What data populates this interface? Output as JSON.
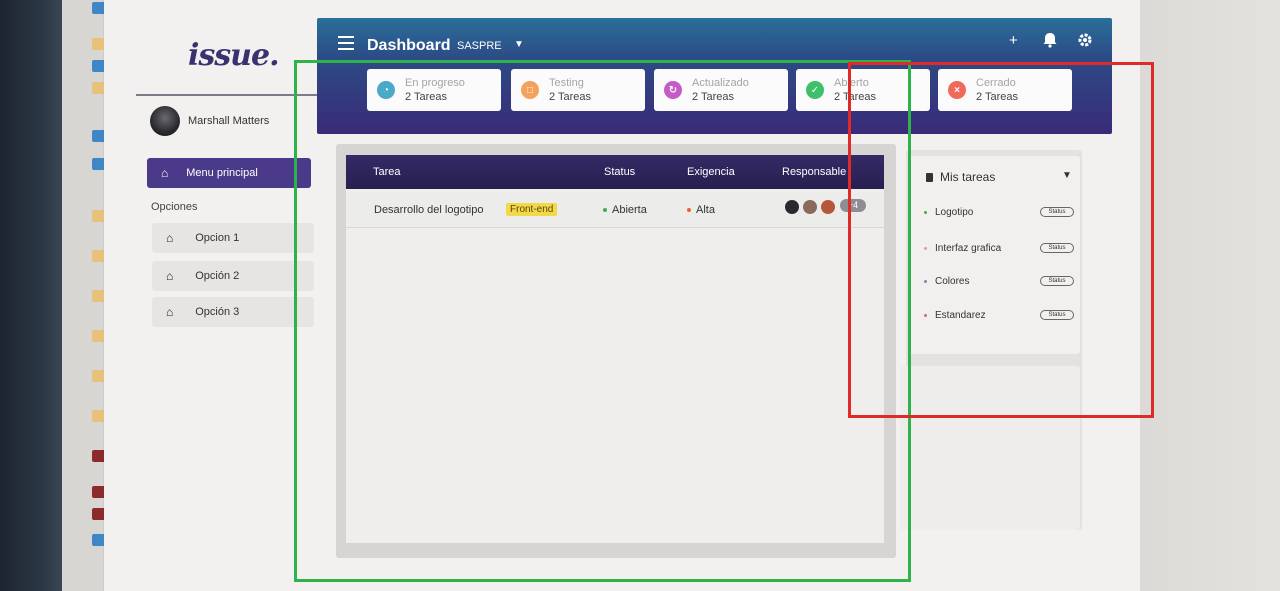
{
  "app": {
    "logo": "issue.",
    "title": "Dashboard",
    "project": "SASPRE"
  },
  "user": {
    "name": "Marshall Matters"
  },
  "sidebar": {
    "main_menu": "Menu principal",
    "options_label": "Opciones",
    "items": [
      {
        "label": "Opcion 1"
      },
      {
        "label": "Opción 2"
      },
      {
        "label": "Opción 3"
      }
    ]
  },
  "header_icons": [
    "plus-icon",
    "bell-icon",
    "gear-icon"
  ],
  "status_cards": [
    {
      "label": "En progreso",
      "count": "2 Tareas",
      "color": "#4aa8c8",
      "icon": "progress-icon"
    },
    {
      "label": "Testing",
      "count": "2 Tareas",
      "color": "#f2a25c",
      "icon": "testing-icon"
    },
    {
      "label": "Actualizado",
      "count": "2 Tareas",
      "color": "#c45cc8",
      "icon": "refresh-icon"
    },
    {
      "label": "Abierto",
      "count": "2 Tareas",
      "color": "#3ec06a",
      "icon": "check-icon"
    },
    {
      "label": "Cerrado",
      "count": "2 Tareas",
      "color": "#ef6a5a",
      "icon": "close-icon"
    }
  ],
  "table": {
    "headers": [
      "Tarea",
      "Status",
      "Exigencia",
      "Responsable"
    ],
    "rows": [
      {
        "task": "Desarrollo del logotipo",
        "tag": "Front-end",
        "status": "Abierta",
        "priority": "Alta",
        "extra": "+4"
      }
    ]
  },
  "my_tasks": {
    "title": "Mis tareas",
    "items": [
      {
        "label": "Logotipo",
        "badge": "Status",
        "dot": "#3bb34b"
      },
      {
        "label": "Interfaz grafica",
        "badge": "Status",
        "dot": "#d9a0a0"
      },
      {
        "label": "Colores",
        "badge": "Status",
        "dot": "#9a7ab0"
      },
      {
        "label": "Estandarez",
        "badge": "Status",
        "dot": "#c07080"
      }
    ]
  },
  "colors": {
    "accent": "#4b3a8a",
    "annotation_green": "#2db34a",
    "annotation_red": "#e02a2a"
  }
}
